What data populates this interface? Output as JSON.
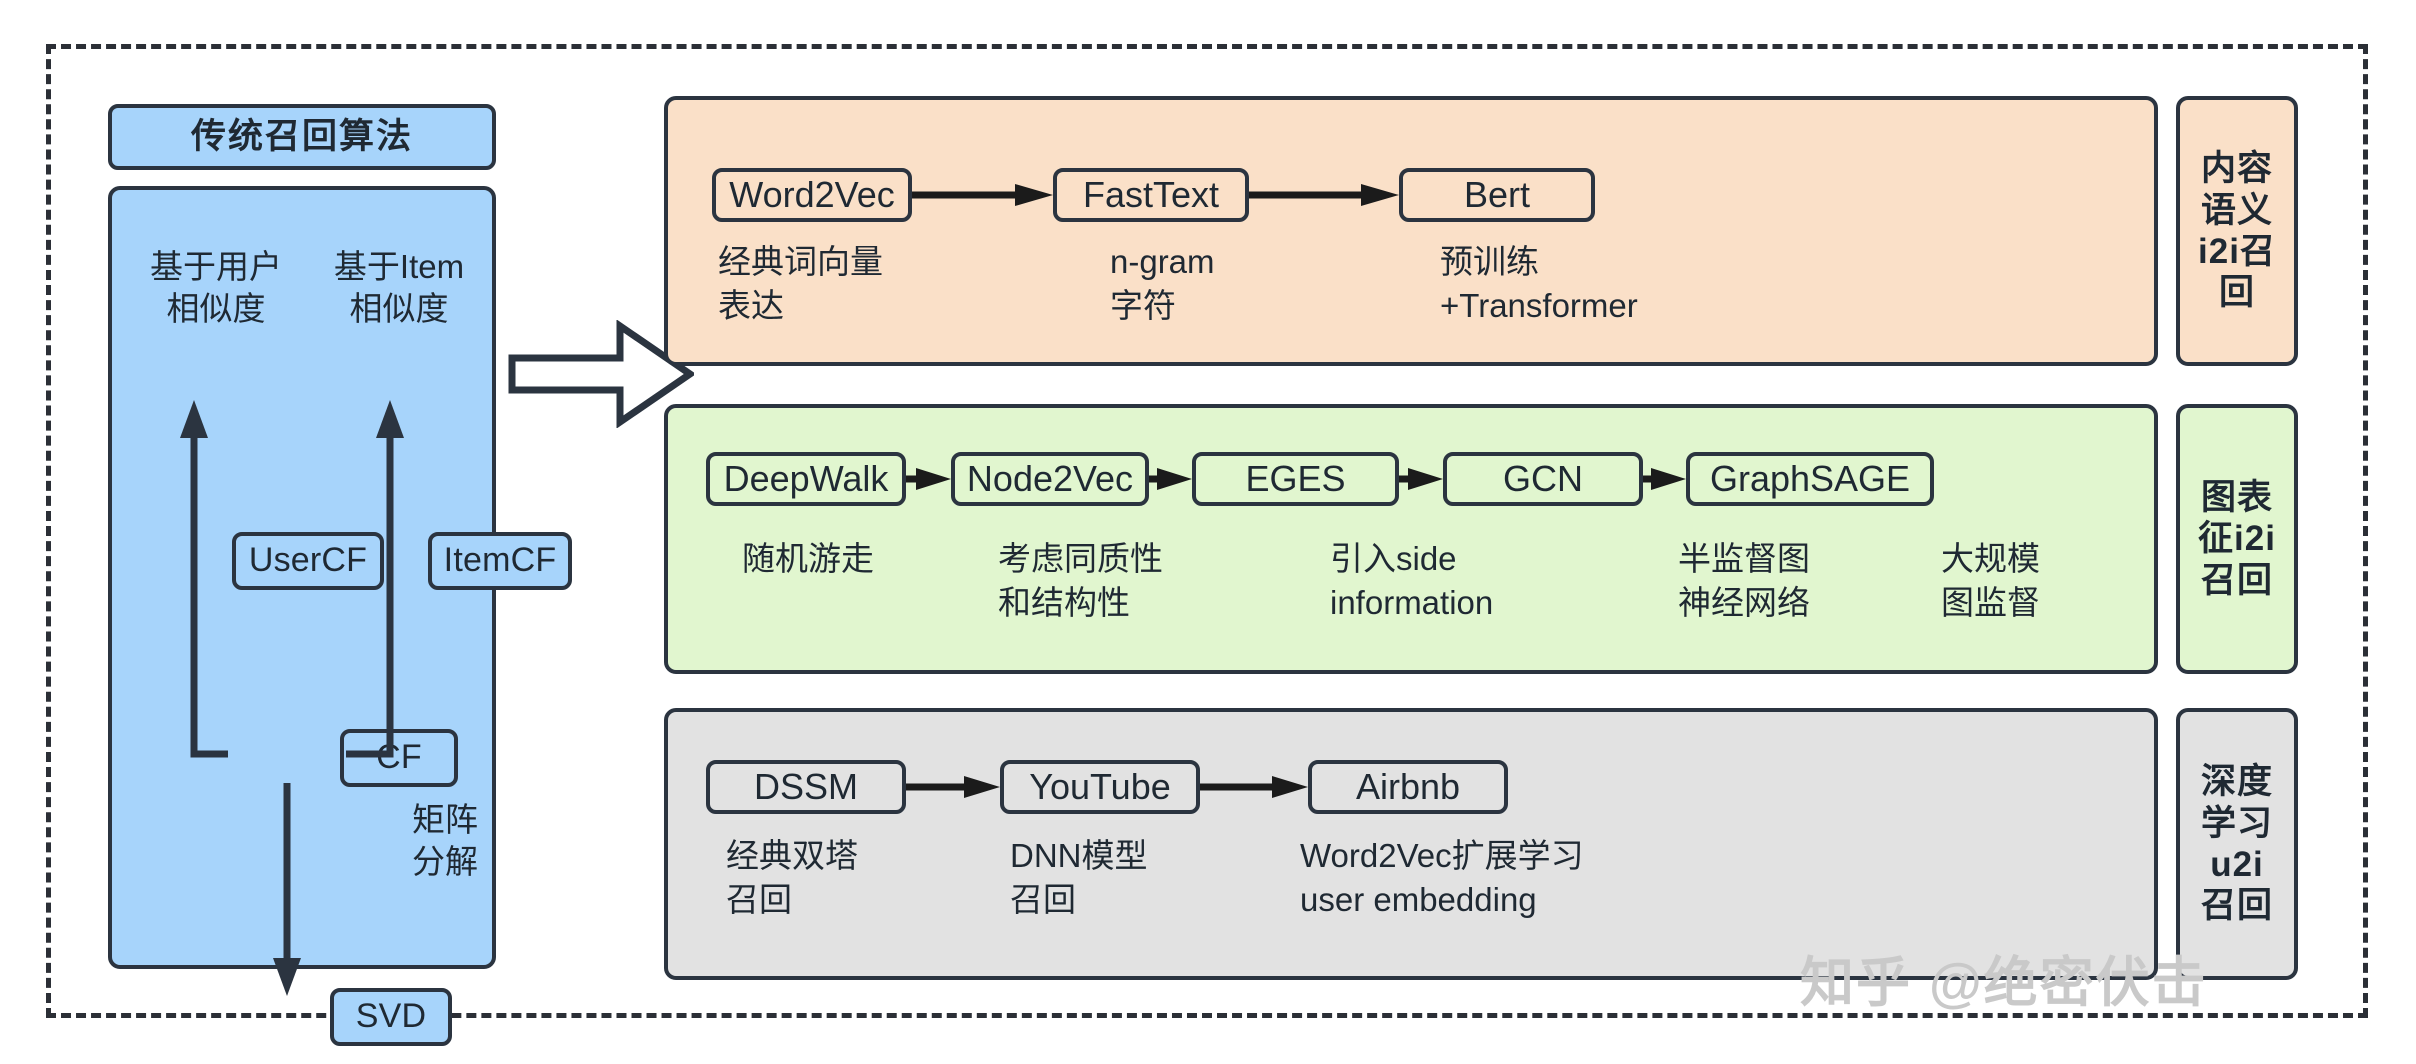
{
  "left": {
    "title": "传统召回算法",
    "caption_user": "基于用户\n相似度",
    "caption_item": "基于Item\n相似度",
    "usercf": "UserCF",
    "itemcf": "ItemCF",
    "cf": "CF",
    "svd": "SVD",
    "caption_matrix": "矩阵\n分解"
  },
  "arrow_label": "flow-arrow",
  "rows": [
    {
      "id": "orange",
      "tag": "内容\n语义\ni2i召\n回",
      "color": "#fae0c8",
      "boxes": [
        {
          "label": "Word2Vec",
          "caption": "经典词向量\n表达"
        },
        {
          "label": "FastText",
          "caption": "n-gram\n字符"
        },
        {
          "label": "Bert",
          "caption": "预训练\n+Transformer"
        }
      ]
    },
    {
      "id": "green",
      "tag": "图表\n征i2i\n召回",
      "color": "#e1f6cf",
      "boxes": [
        {
          "label": "DeepWalk",
          "caption": "随机游走"
        },
        {
          "label": "Node2Vec",
          "caption": "考虑同质性\n和结构性"
        },
        {
          "label": "EGES",
          "caption": "引入side\ninformation"
        },
        {
          "label": "GCN",
          "caption": "半监督图\n神经网络"
        },
        {
          "label": "GraphSAGE",
          "caption": "大规模\n图监督"
        }
      ]
    },
    {
      "id": "gray",
      "tag": "深度\n学习\nu2i\n召回",
      "color": "#e2e2e2",
      "boxes": [
        {
          "label": "DSSM",
          "caption": "经典双塔\n召回"
        },
        {
          "label": "YouTube",
          "caption": "DNN模型\n召回"
        },
        {
          "label": "Airbnb",
          "caption": "Word2Vec扩展学习\nuser embedding"
        }
      ]
    }
  ],
  "watermark": "知乎 @绝密伏击",
  "colors": {
    "blue_panel": "#a7d4fb",
    "orange_panel": "#fae0c8",
    "green_panel": "#e1f6cf",
    "gray_panel": "#e2e2e2",
    "stroke": "#2b3440"
  }
}
